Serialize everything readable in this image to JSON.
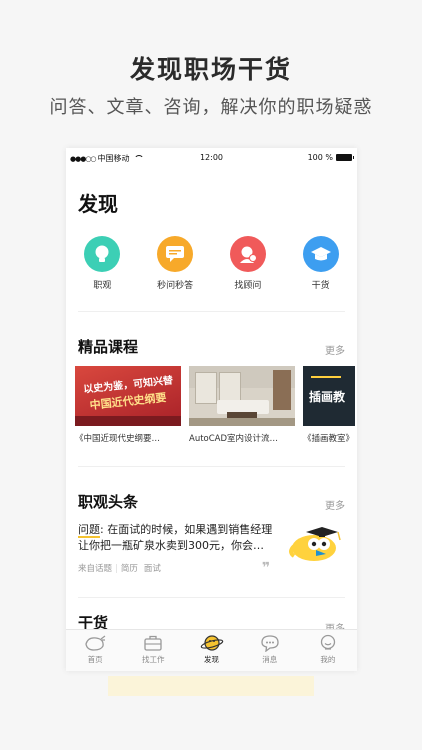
{
  "promo": {
    "title": "发现职场干货",
    "subtitle": "问答、文章、咨询，解决你的职场疑惑"
  },
  "status_bar": {
    "carrier": "中国移动",
    "time": "12:00",
    "battery": "100 %"
  },
  "page": {
    "title": "发现"
  },
  "quick_links": [
    {
      "label": "职观",
      "icon": "bulb-icon",
      "color": "#3ccfb5"
    },
    {
      "label": "秒问秒答",
      "icon": "chat-bubble-icon",
      "color": "#f7a92a"
    },
    {
      "label": "找顾问",
      "icon": "consultant-icon",
      "color": "#f05a5a"
    },
    {
      "label": "干货",
      "icon": "graduation-cap-icon",
      "color": "#3d9ef0"
    }
  ],
  "courses": {
    "title": "精品课程",
    "more": "更多",
    "items": [
      {
        "title": "《中国近现代史纲要…",
        "thumb_text_top": "以史为鉴，可知兴替",
        "thumb_text_bottom": "中国近代史纲要"
      },
      {
        "title": "AutoCAD室内设计流…"
      },
      {
        "title": "《插画教室》",
        "thumb_text": "插画教"
      }
    ]
  },
  "headlines": {
    "title": "职观头条",
    "more": "更多",
    "question_tag": "问题",
    "question_text": ": 在面试的时候，如果遇到销售经理让你把一瓶矿泉水卖到300元，你会…",
    "meta": [
      "来自话题",
      "简历",
      "面试"
    ],
    "quote_glyph": "❞"
  },
  "next_section": {
    "title": "干货",
    "more": "更多"
  },
  "tabbar": [
    {
      "label": "首页",
      "icon": "whale-icon",
      "active": false
    },
    {
      "label": "找工作",
      "icon": "briefcase-icon",
      "active": false
    },
    {
      "label": "发现",
      "icon": "planet-icon",
      "active": true
    },
    {
      "label": "消息",
      "icon": "message-icon",
      "active": false
    },
    {
      "label": "我的",
      "icon": "profile-icon",
      "active": false
    }
  ],
  "colors": {
    "accent": "#f5c330",
    "text": "#222222",
    "muted": "#999999"
  }
}
